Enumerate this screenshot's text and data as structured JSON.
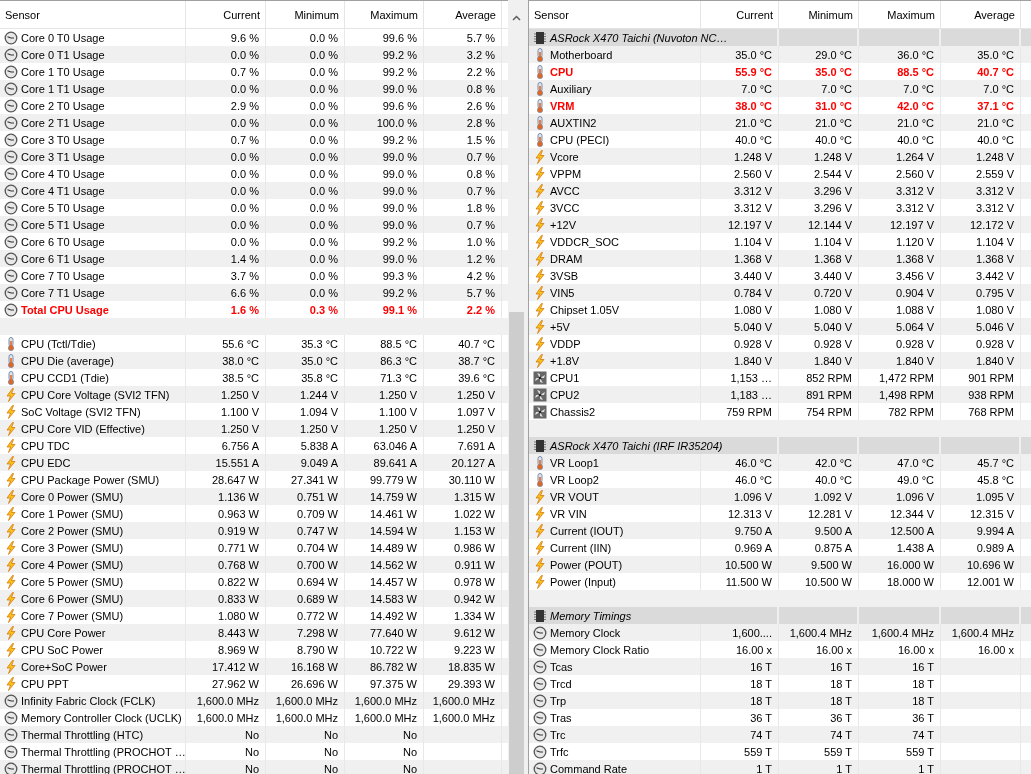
{
  "panels": [
    {
      "columns": [
        "Sensor",
        "Current",
        "Minimum",
        "Maximum",
        "Average"
      ],
      "rows": [
        {
          "kind": "gauge",
          "label": "Core 0 T0 Usage",
          "values": [
            "9.6 %",
            "0.0 %",
            "99.6 %",
            "5.7 %"
          ],
          "alert": false
        },
        {
          "kind": "gauge",
          "label": "Core 0 T1 Usage",
          "values": [
            "0.0 %",
            "0.0 %",
            "99.2 %",
            "3.2 %"
          ],
          "alert": false
        },
        {
          "kind": "gauge",
          "label": "Core 1 T0 Usage",
          "values": [
            "0.7 %",
            "0.0 %",
            "99.2 %",
            "2.2 %"
          ],
          "alert": false
        },
        {
          "kind": "gauge",
          "label": "Core 1 T1 Usage",
          "values": [
            "0.0 %",
            "0.0 %",
            "99.0 %",
            "0.8 %"
          ],
          "alert": false
        },
        {
          "kind": "gauge",
          "label": "Core 2 T0 Usage",
          "values": [
            "2.9 %",
            "0.0 %",
            "99.6 %",
            "2.6 %"
          ],
          "alert": false
        },
        {
          "kind": "gauge",
          "label": "Core 2 T1 Usage",
          "values": [
            "0.0 %",
            "0.0 %",
            "100.0 %",
            "2.8 %"
          ],
          "alert": false
        },
        {
          "kind": "gauge",
          "label": "Core 3 T0 Usage",
          "values": [
            "0.7 %",
            "0.0 %",
            "99.2 %",
            "1.5 %"
          ],
          "alert": false
        },
        {
          "kind": "gauge",
          "label": "Core 3 T1 Usage",
          "values": [
            "0.0 %",
            "0.0 %",
            "99.0 %",
            "0.7 %"
          ],
          "alert": false
        },
        {
          "kind": "gauge",
          "label": "Core 4 T0 Usage",
          "values": [
            "0.0 %",
            "0.0 %",
            "99.0 %",
            "0.8 %"
          ],
          "alert": false
        },
        {
          "kind": "gauge",
          "label": "Core 4 T1 Usage",
          "values": [
            "0.0 %",
            "0.0 %",
            "99.0 %",
            "0.7 %"
          ],
          "alert": false
        },
        {
          "kind": "gauge",
          "label": "Core 5 T0 Usage",
          "values": [
            "0.0 %",
            "0.0 %",
            "99.0 %",
            "1.8 %"
          ],
          "alert": false
        },
        {
          "kind": "gauge",
          "label": "Core 5 T1 Usage",
          "values": [
            "0.0 %",
            "0.0 %",
            "99.0 %",
            "0.7 %"
          ],
          "alert": false
        },
        {
          "kind": "gauge",
          "label": "Core 6 T0 Usage",
          "values": [
            "0.0 %",
            "0.0 %",
            "99.2 %",
            "1.0 %"
          ],
          "alert": false
        },
        {
          "kind": "gauge",
          "label": "Core 6 T1 Usage",
          "values": [
            "1.4 %",
            "0.0 %",
            "99.0 %",
            "1.2 %"
          ],
          "alert": false
        },
        {
          "kind": "gauge",
          "label": "Core 7 T0 Usage",
          "values": [
            "3.7 %",
            "0.0 %",
            "99.3 %",
            "4.2 %"
          ],
          "alert": false
        },
        {
          "kind": "gauge",
          "label": "Core 7 T1 Usage",
          "values": [
            "6.6 %",
            "0.0 %",
            "99.2 %",
            "5.7 %"
          ],
          "alert": false
        },
        {
          "kind": "gauge",
          "label": "Total CPU Usage",
          "values": [
            "1.6 %",
            "0.3 %",
            "99.1 %",
            "2.2 %"
          ],
          "alert": true
        },
        {
          "kind": "spacer"
        },
        {
          "kind": "temperature",
          "label": "CPU (Tctl/Tdie)",
          "values": [
            "55.6 °C",
            "35.3 °C",
            "88.5 °C",
            "40.7 °C"
          ],
          "alert": false
        },
        {
          "kind": "temperature",
          "label": "CPU Die (average)",
          "values": [
            "38.0 °C",
            "35.0 °C",
            "86.3 °C",
            "38.7 °C"
          ],
          "alert": false
        },
        {
          "kind": "temperature",
          "label": "CPU CCD1 (Tdie)",
          "values": [
            "38.5 °C",
            "35.8 °C",
            "71.3 °C",
            "39.6 °C"
          ],
          "alert": false
        },
        {
          "kind": "electric",
          "label": "CPU Core Voltage (SVI2 TFN)",
          "values": [
            "1.250 V",
            "1.244 V",
            "1.250 V",
            "1.250 V"
          ],
          "alert": false
        },
        {
          "kind": "electric",
          "label": "SoC Voltage (SVI2 TFN)",
          "values": [
            "1.100 V",
            "1.094 V",
            "1.100 V",
            "1.097 V"
          ],
          "alert": false
        },
        {
          "kind": "electric",
          "label": "CPU Core VID (Effective)",
          "values": [
            "1.250 V",
            "1.250 V",
            "1.250 V",
            "1.250 V"
          ],
          "alert": false
        },
        {
          "kind": "electric",
          "label": "CPU TDC",
          "values": [
            "6.756 A",
            "5.838 A",
            "63.046 A",
            "7.691 A"
          ],
          "alert": false
        },
        {
          "kind": "electric",
          "label": "CPU EDC",
          "values": [
            "15.551 A",
            "9.049 A",
            "89.641 A",
            "20.127 A"
          ],
          "alert": false
        },
        {
          "kind": "electric",
          "label": "CPU Package Power (SMU)",
          "values": [
            "28.647 W",
            "27.341 W",
            "99.779 W",
            "30.110 W"
          ],
          "alert": false
        },
        {
          "kind": "electric",
          "label": "Core 0 Power (SMU)",
          "values": [
            "1.136 W",
            "0.751 W",
            "14.759 W",
            "1.315 W"
          ],
          "alert": false
        },
        {
          "kind": "electric",
          "label": "Core 1 Power (SMU)",
          "values": [
            "0.963 W",
            "0.709 W",
            "14.461 W",
            "1.022 W"
          ],
          "alert": false
        },
        {
          "kind": "electric",
          "label": "Core 2 Power (SMU)",
          "values": [
            "0.919 W",
            "0.747 W",
            "14.594 W",
            "1.153 W"
          ],
          "alert": false
        },
        {
          "kind": "electric",
          "label": "Core 3 Power (SMU)",
          "values": [
            "0.771 W",
            "0.704 W",
            "14.489 W",
            "0.986 W"
          ],
          "alert": false
        },
        {
          "kind": "electric",
          "label": "Core 4 Power (SMU)",
          "values": [
            "0.768 W",
            "0.700 W",
            "14.562 W",
            "0.911 W"
          ],
          "alert": false
        },
        {
          "kind": "electric",
          "label": "Core 5 Power (SMU)",
          "values": [
            "0.822 W",
            "0.694 W",
            "14.457 W",
            "0.978 W"
          ],
          "alert": false
        },
        {
          "kind": "electric",
          "label": "Core 6 Power (SMU)",
          "values": [
            "0.833 W",
            "0.689 W",
            "14.583 W",
            "0.942 W"
          ],
          "alert": false
        },
        {
          "kind": "electric",
          "label": "Core 7 Power (SMU)",
          "values": [
            "1.080 W",
            "0.772 W",
            "14.492 W",
            "1.334 W"
          ],
          "alert": false
        },
        {
          "kind": "electric",
          "label": "CPU Core Power",
          "values": [
            "8.443 W",
            "7.298 W",
            "77.640 W",
            "9.612 W"
          ],
          "alert": false
        },
        {
          "kind": "electric",
          "label": "CPU SoC Power",
          "values": [
            "8.969 W",
            "8.790 W",
            "10.722 W",
            "9.223 W"
          ],
          "alert": false
        },
        {
          "kind": "electric",
          "label": "Core+SoC Power",
          "values": [
            "17.412 W",
            "16.168 W",
            "86.782 W",
            "18.835 W"
          ],
          "alert": false
        },
        {
          "kind": "electric",
          "label": "CPU PPT",
          "values": [
            "27.962 W",
            "26.696 W",
            "97.375 W",
            "29.393 W"
          ],
          "alert": false
        },
        {
          "kind": "gauge",
          "label": "Infinity Fabric Clock (FCLK)",
          "values": [
            "1,600.0 MHz",
            "1,600.0 MHz",
            "1,600.0 MHz",
            "1,600.0 MHz"
          ],
          "alert": false
        },
        {
          "kind": "gauge",
          "label": "Memory Controller Clock (UCLK)",
          "values": [
            "1,600.0 MHz",
            "1,600.0 MHz",
            "1,600.0 MHz",
            "1,600.0 MHz"
          ],
          "alert": false
        },
        {
          "kind": "gauge",
          "label": "Thermal Throttling (HTC)",
          "values": [
            "No",
            "No",
            "No"
          ],
          "alert": false
        },
        {
          "kind": "gauge",
          "label": "Thermal Throttling (PROCHOT …",
          "values": [
            "No",
            "No",
            "No"
          ],
          "alert": false
        },
        {
          "kind": "gauge",
          "label": "Thermal Throttling (PROCHOT …",
          "values": [
            "No",
            "No",
            "No"
          ],
          "alert": false
        }
      ]
    },
    {
      "columns": [
        "Sensor",
        "Current",
        "Minimum",
        "Maximum",
        "Average"
      ],
      "rows": [
        {
          "kind": "group",
          "label": "ASRock X470 Taichi (Nuvoton NC…"
        },
        {
          "kind": "temperature",
          "label": "Motherboard",
          "values": [
            "35.0 °C",
            "29.0 °C",
            "36.0 °C",
            "35.0 °C"
          ],
          "alert": false
        },
        {
          "kind": "temperature",
          "label": "CPU",
          "values": [
            "55.9 °C",
            "35.0 °C",
            "88.5 °C",
            "40.7 °C"
          ],
          "alert": true
        },
        {
          "kind": "temperature",
          "label": "Auxiliary",
          "values": [
            "7.0 °C",
            "7.0 °C",
            "7.0 °C",
            "7.0 °C"
          ],
          "alert": false
        },
        {
          "kind": "temperature",
          "label": "VRM",
          "values": [
            "38.0 °C",
            "31.0 °C",
            "42.0 °C",
            "37.1 °C"
          ],
          "alert": true
        },
        {
          "kind": "temperature",
          "label": "AUXTIN2",
          "values": [
            "21.0 °C",
            "21.0 °C",
            "21.0 °C",
            "21.0 °C"
          ],
          "alert": false
        },
        {
          "kind": "temperature",
          "label": "CPU (PECI)",
          "values": [
            "40.0 °C",
            "40.0 °C",
            "40.0 °C",
            "40.0 °C"
          ],
          "alert": false
        },
        {
          "kind": "electric",
          "label": "Vcore",
          "values": [
            "1.248 V",
            "1.248 V",
            "1.264 V",
            "1.248 V"
          ],
          "alert": false
        },
        {
          "kind": "electric",
          "label": "VPPM",
          "values": [
            "2.560 V",
            "2.544 V",
            "2.560 V",
            "2.559 V"
          ],
          "alert": false
        },
        {
          "kind": "electric",
          "label": "AVCC",
          "values": [
            "3.312 V",
            "3.296 V",
            "3.312 V",
            "3.312 V"
          ],
          "alert": false
        },
        {
          "kind": "electric",
          "label": "3VCC",
          "values": [
            "3.312 V",
            "3.296 V",
            "3.312 V",
            "3.312 V"
          ],
          "alert": false
        },
        {
          "kind": "electric",
          "label": "+12V",
          "values": [
            "12.197 V",
            "12.144 V",
            "12.197 V",
            "12.172 V"
          ],
          "alert": false
        },
        {
          "kind": "electric",
          "label": "VDDCR_SOC",
          "values": [
            "1.104 V",
            "1.104 V",
            "1.120 V",
            "1.104 V"
          ],
          "alert": false
        },
        {
          "kind": "electric",
          "label": "DRAM",
          "values": [
            "1.368 V",
            "1.368 V",
            "1.368 V",
            "1.368 V"
          ],
          "alert": false
        },
        {
          "kind": "electric",
          "label": "3VSB",
          "values": [
            "3.440 V",
            "3.440 V",
            "3.456 V",
            "3.442 V"
          ],
          "alert": false
        },
        {
          "kind": "electric",
          "label": "VIN5",
          "values": [
            "0.784 V",
            "0.720 V",
            "0.904 V",
            "0.795 V"
          ],
          "alert": false
        },
        {
          "kind": "electric",
          "label": "Chipset 1.05V",
          "values": [
            "1.080 V",
            "1.080 V",
            "1.088 V",
            "1.080 V"
          ],
          "alert": false
        },
        {
          "kind": "electric",
          "label": "+5V",
          "values": [
            "5.040 V",
            "5.040 V",
            "5.064 V",
            "5.046 V"
          ],
          "alert": false
        },
        {
          "kind": "electric",
          "label": "VDDP",
          "values": [
            "0.928 V",
            "0.928 V",
            "0.928 V",
            "0.928 V"
          ],
          "alert": false
        },
        {
          "kind": "electric",
          "label": "+1.8V",
          "values": [
            "1.840 V",
            "1.840 V",
            "1.840 V",
            "1.840 V"
          ],
          "alert": false
        },
        {
          "kind": "fan",
          "label": "CPU1",
          "values": [
            "1,153 …",
            "852 RPM",
            "1,472 RPM",
            "901 RPM"
          ],
          "alert": false
        },
        {
          "kind": "fan",
          "label": "CPU2",
          "values": [
            "1,183 …",
            "891 RPM",
            "1,498 RPM",
            "938 RPM"
          ],
          "alert": false
        },
        {
          "kind": "fan",
          "label": "Chassis2",
          "values": [
            "759 RPM",
            "754 RPM",
            "782 RPM",
            "768 RPM"
          ],
          "alert": false
        },
        {
          "kind": "spacer"
        },
        {
          "kind": "group",
          "label": "ASRock X470 Taichi (IRF IR35204)"
        },
        {
          "kind": "temperature",
          "label": "VR Loop1",
          "values": [
            "46.0 °C",
            "42.0 °C",
            "47.0 °C",
            "45.7 °C"
          ],
          "alert": false
        },
        {
          "kind": "temperature",
          "label": "VR Loop2",
          "values": [
            "46.0 °C",
            "40.0 °C",
            "49.0 °C",
            "45.8 °C"
          ],
          "alert": false
        },
        {
          "kind": "electric",
          "label": "VR VOUT",
          "values": [
            "1.096 V",
            "1.092 V",
            "1.096 V",
            "1.095 V"
          ],
          "alert": false
        },
        {
          "kind": "electric",
          "label": "VR VIN",
          "values": [
            "12.313 V",
            "12.281 V",
            "12.344 V",
            "12.315 V"
          ],
          "alert": false
        },
        {
          "kind": "electric",
          "label": "Current (IOUT)",
          "values": [
            "9.750 A",
            "9.500 A",
            "12.500 A",
            "9.994 A"
          ],
          "alert": false
        },
        {
          "kind": "electric",
          "label": "Current (IIN)",
          "values": [
            "0.969 A",
            "0.875 A",
            "1.438 A",
            "0.989 A"
          ],
          "alert": false
        },
        {
          "kind": "electric",
          "label": "Power (POUT)",
          "values": [
            "10.500 W",
            "9.500 W",
            "16.000 W",
            "10.696 W"
          ],
          "alert": false
        },
        {
          "kind": "electric",
          "label": "Power (Input)",
          "values": [
            "11.500 W",
            "10.500 W",
            "18.000 W",
            "12.001 W"
          ],
          "alert": false
        },
        {
          "kind": "spacer"
        },
        {
          "kind": "group",
          "label": "Memory Timings"
        },
        {
          "kind": "gauge",
          "label": "Memory Clock",
          "values": [
            "1,600....",
            "1,600.4 MHz",
            "1,600.4 MHz",
            "1,600.4 MHz"
          ],
          "alert": false
        },
        {
          "kind": "gauge",
          "label": "Memory Clock Ratio",
          "values": [
            "16.00 x",
            "16.00 x",
            "16.00 x",
            "16.00 x"
          ],
          "alert": false
        },
        {
          "kind": "gauge",
          "label": "Tcas",
          "values": [
            "16 T",
            "16 T",
            "16 T"
          ],
          "alert": false
        },
        {
          "kind": "gauge",
          "label": "Trcd",
          "values": [
            "18 T",
            "18 T",
            "18 T"
          ],
          "alert": false
        },
        {
          "kind": "gauge",
          "label": "Trp",
          "values": [
            "18 T",
            "18 T",
            "18 T"
          ],
          "alert": false
        },
        {
          "kind": "gauge",
          "label": "Tras",
          "values": [
            "36 T",
            "36 T",
            "36 T"
          ],
          "alert": false
        },
        {
          "kind": "gauge",
          "label": "Trc",
          "values": [
            "74 T",
            "74 T",
            "74 T"
          ],
          "alert": false
        },
        {
          "kind": "gauge",
          "label": "Trfc",
          "values": [
            "559 T",
            "559 T",
            "559 T"
          ],
          "alert": false
        },
        {
          "kind": "gauge",
          "label": "Command Rate",
          "values": [
            "1 T",
            "1 T",
            "1 T"
          ],
          "alert": false
        }
      ]
    }
  ]
}
